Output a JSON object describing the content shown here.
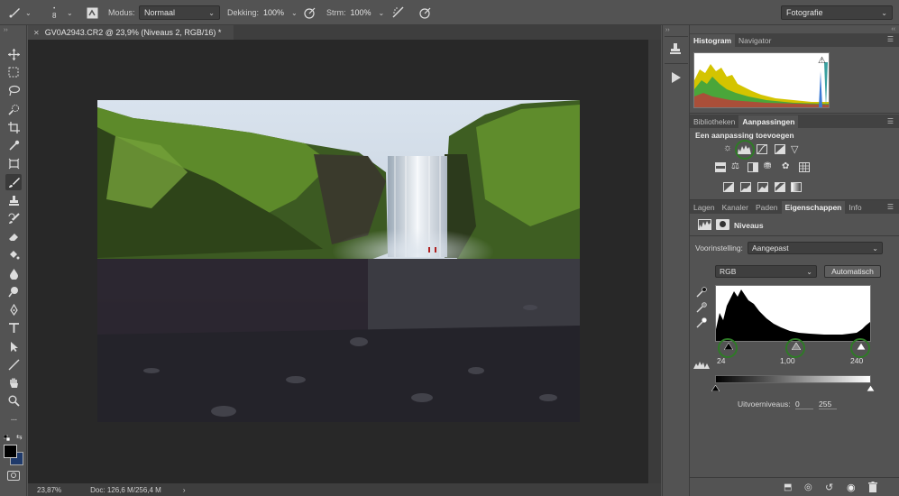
{
  "optionsbar": {
    "brush_size": "8",
    "mode_label": "Modus:",
    "mode_value": "Normaal",
    "opacity_label": "Dekking:",
    "opacity_value": "100%",
    "flow_label": "Strm:",
    "flow_value": "100%",
    "workspace_value": "Fotografie"
  },
  "document": {
    "tab_title": "GV0A2943.CR2 @ 23,9% (Niveaus 2, RGB/16) *",
    "zoom": "23,87%",
    "doc_size": "Doc: 126,6 M/256,4 M"
  },
  "toolbar": {
    "tools": [
      "move-icon",
      "marquee-icon",
      "lasso-icon",
      "quick-select-icon",
      "crop-icon",
      "frame-icon",
      "eyedropper-icon",
      "healing-icon",
      "brush-icon",
      "stamp-icon",
      "history-brush-icon",
      "eraser-icon",
      "paint-bucket-icon",
      "blur-icon",
      "dodge-icon",
      "pen-icon",
      "type-icon",
      "path-select-icon",
      "line-icon",
      "hand-icon",
      "zoom-icon",
      "more-icon"
    ],
    "active_tool": "brush-icon"
  },
  "histogram_panel": {
    "tabs": [
      "Histogram",
      "Navigator"
    ],
    "active_tab": "Histogram"
  },
  "adjustments_panel": {
    "tabs": [
      "Bibliotheken",
      "Aanpassingen"
    ],
    "active_tab": "Aanpassingen",
    "heading": "Een aanpassing toevoegen"
  },
  "properties_panel": {
    "tabs": [
      "Lagen",
      "Kanaler",
      "Paden",
      "Eigenschappen",
      "Info"
    ],
    "active_tab": "Eigenschappen",
    "layer_title": "Niveaus",
    "preset_label": "Voorinstelling:",
    "preset_value": "Aangepast",
    "channel_value": "RGB",
    "auto_button": "Automatisch",
    "input_black": "24",
    "input_gamma": "1,00",
    "input_white": "240",
    "output_label": "Uitvoerniveaus:",
    "output_black": "0",
    "output_white": "255"
  },
  "colors": {
    "ui_bg": "#535353",
    "canvas_bg": "#282828",
    "highlight_ring": "#2e7a26",
    "foreground": "#000000",
    "background": "#1f3a6b"
  }
}
